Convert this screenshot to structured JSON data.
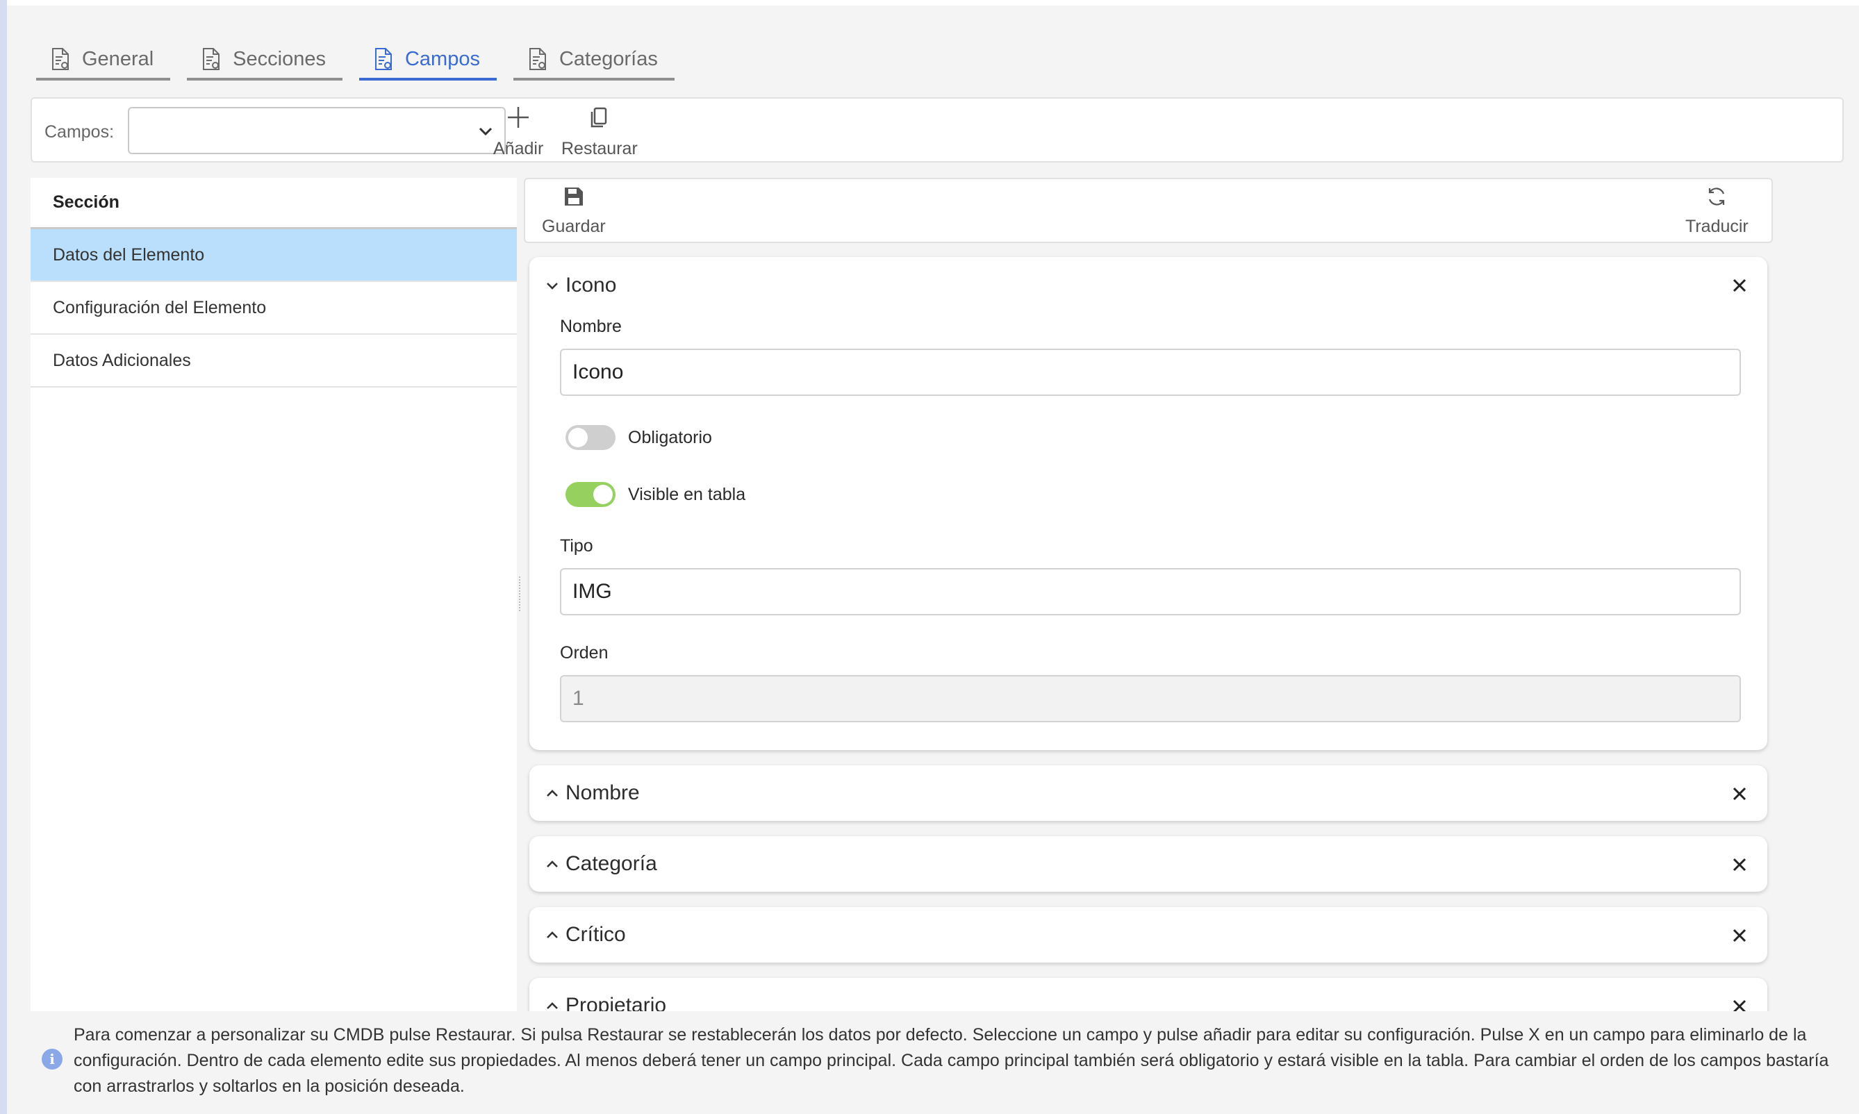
{
  "tabs": [
    {
      "label": "General",
      "icon": "document-settings-icon",
      "active": false
    },
    {
      "label": "Secciones",
      "icon": "document-settings-icon",
      "active": false
    },
    {
      "label": "Campos",
      "icon": "document-settings-icon",
      "active": true
    },
    {
      "label": "Categorías",
      "icon": "document-settings-icon",
      "active": false
    }
  ],
  "toolbar": {
    "campos_label": "Campos:",
    "campos_value": "",
    "add_label": "Añadir",
    "restore_label": "Restaurar"
  },
  "sections": {
    "header": "Sección",
    "items": [
      {
        "label": "Datos del Elemento",
        "selected": true
      },
      {
        "label": "Configuración del Elemento",
        "selected": false
      },
      {
        "label": "Datos Adicionales",
        "selected": false
      }
    ]
  },
  "right_toolbar": {
    "save_label": "Guardar",
    "translate_label": "Traducir"
  },
  "expanded_field": {
    "title": "Icono",
    "name_label": "Nombre",
    "name_value": "Icono",
    "required_label": "Obligatorio",
    "required_on": false,
    "visible_label": "Visible en tabla",
    "visible_on": true,
    "type_label": "Tipo",
    "type_value": "IMG",
    "order_label": "Orden",
    "order_value": "1"
  },
  "collapsed_fields": [
    {
      "title": "Nombre"
    },
    {
      "title": "Categoría"
    },
    {
      "title": "Crítico"
    },
    {
      "title": "Propietario"
    }
  ],
  "info": {
    "icon": "info-icon",
    "icon_glyph": "i",
    "text": "Para comenzar a personalizar su CMDB pulse Restaurar. Si pulsa Restaurar se restablecerán los datos por defecto. Seleccione un campo y pulse añadir para editar su configuración. Pulse X en un campo para eliminarlo de la configuración. Dentro de cada elemento edite sus propiedades. Al menos deberá tener un campo principal. Cada campo principal también será obligatorio y estará visible en la tabla. Para cambiar el orden de los campos bastaría con arrastrarlos y soltarlos en la posición deseada."
  },
  "colors": {
    "accent": "#3b6bd2",
    "selected_row": "#b9dffc",
    "toggle_on": "#96d160",
    "toggle_off": "#cfcfcf"
  }
}
